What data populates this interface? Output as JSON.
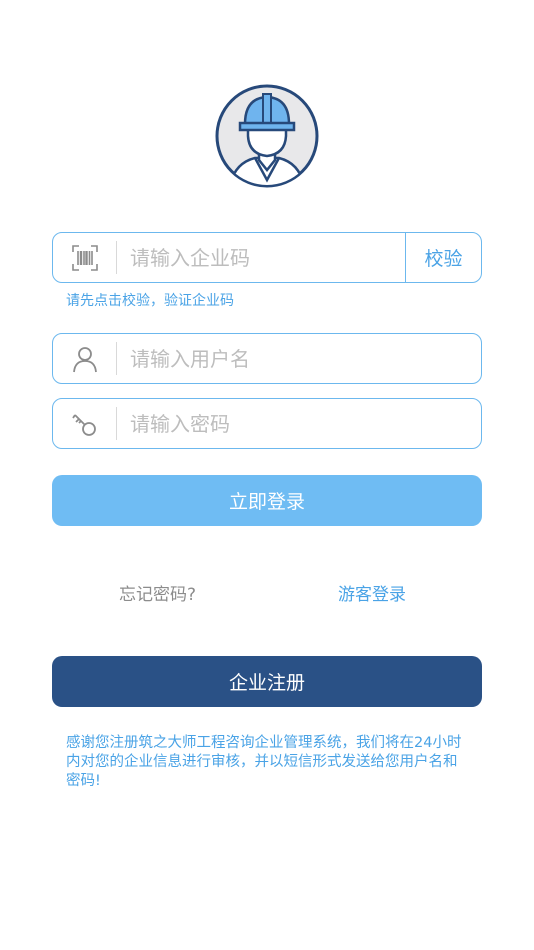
{
  "avatar": {
    "icon": "construction-worker-icon"
  },
  "company_code": {
    "icon": "barcode-icon",
    "placeholder": "请输入企业码",
    "value": "",
    "verify_label": "校验",
    "hint": "请先点击校验，验证企业码"
  },
  "username": {
    "icon": "user-icon",
    "placeholder": "请输入用户名",
    "value": ""
  },
  "password": {
    "icon": "key-icon",
    "placeholder": "请输入密码",
    "value": ""
  },
  "login_button": "立即登录",
  "forgot_password": "忘记密码?",
  "guest_login": "游客登录",
  "register_button": "企业注册",
  "notice": "感谢您注册筑之大师工程咨询企业管理系统，我们将在24小时内对您的企业信息进行审核，并以短信形式发送给您用户名和密码!",
  "colors": {
    "accent": "#4aa3e6",
    "field_border": "#6cb8ee",
    "login_button": "#6fbcf3",
    "register_button": "#2a5186"
  }
}
